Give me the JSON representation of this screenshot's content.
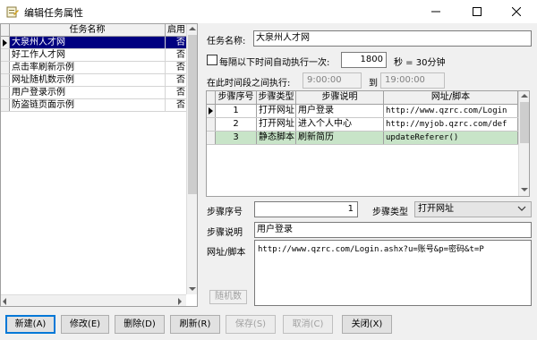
{
  "window": {
    "title": "编辑任务属性"
  },
  "task_list": {
    "headers": [
      "任务名称",
      "启用"
    ],
    "rows": [
      {
        "name": "大泉州人才网",
        "enabled": "否"
      },
      {
        "name": "好工作人才网",
        "enabled": "否"
      },
      {
        "name": "点击率刷新示例",
        "enabled": "否"
      },
      {
        "name": "网址随机数示例",
        "enabled": "否"
      },
      {
        "name": "用户登录示例",
        "enabled": "否"
      },
      {
        "name": "防盗链页面示例",
        "enabled": "否"
      }
    ]
  },
  "form": {
    "task_name_label": "任务名称:",
    "task_name_value": "大泉州人才网",
    "interval_label": "每隔以下时间自动执行一次:",
    "interval_value": "1800",
    "interval_unit": "秒 = 30分钟",
    "range_label": "在此时间段之间执行:",
    "start_time": "9:00:00",
    "to_label": "到",
    "end_time": "19:00:00"
  },
  "steps": {
    "headers": [
      "步骤序号",
      "步骤类型",
      "步骤说明",
      "网址/脚本"
    ],
    "rows": [
      {
        "no": "1",
        "type": "打开网址",
        "desc": "用户登录",
        "url": "http://www.qzrc.com/Login"
      },
      {
        "no": "2",
        "type": "打开网址",
        "desc": "进入个人中心",
        "url": "http://myjob.qzrc.com/def"
      },
      {
        "no": "3",
        "type": "静态脚本",
        "desc": "刷新简历",
        "url": "updateReferer()"
      }
    ]
  },
  "step_detail": {
    "seq_label": "步骤序号",
    "seq_value": "1",
    "type_label": "步骤类型",
    "type_value": "打开网址",
    "desc_label": "步骤说明",
    "desc_value": "用户登录",
    "url_label": "网址/脚本",
    "url_value": "http://www.qzrc.com/Login.ashx?u=账号&p=密码&t=P",
    "random_button": "随机数"
  },
  "buttons": {
    "new": "新建(A)",
    "edit": "修改(E)",
    "delete": "删除(D)",
    "refresh": "刷新(R)",
    "save": "保存(S)",
    "cancel": "取消(C)",
    "close": "关闭(X)"
  },
  "colors": {
    "selection": "#000080",
    "highlight_row": "#c8e4c8",
    "primary_border": "#0078d7"
  }
}
